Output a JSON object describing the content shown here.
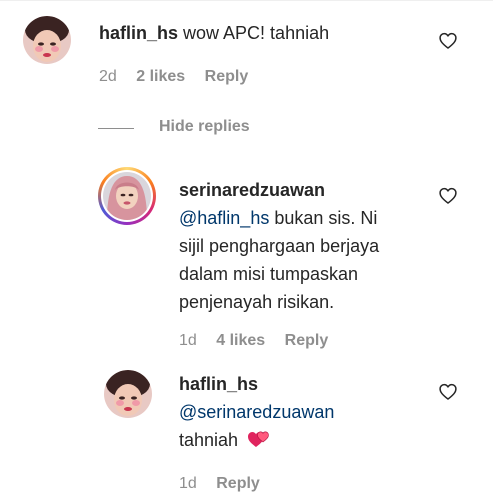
{
  "comment1": {
    "username": "haflin_hs",
    "text": "wow APC! tahniah",
    "age": "2d",
    "likes": "2 likes",
    "reply_label": "Reply"
  },
  "replies_toggle": {
    "label": "Hide replies"
  },
  "reply1": {
    "username": "serinaredzuawan",
    "mention": "@haflin_hs",
    "line1_rest": " bukan sis. Ni",
    "line2": "sijil penghargaan berjaya",
    "line3": "dalam misi tumpaskan",
    "line4": "penjenayah risikan.",
    "age": "1d",
    "likes": "4 likes",
    "reply_label": "Reply"
  },
  "reply2": {
    "username": "haflin_hs",
    "mention": "@serinaredzuawan",
    "text": "tahniah",
    "age": "1d",
    "reply_label": "Reply"
  },
  "icons": {
    "like": "heart-outline-icon",
    "emoji": "two-hearts-emoji"
  },
  "colors": {
    "mention": "#00376b",
    "secondary": "#8e8e8e"
  }
}
